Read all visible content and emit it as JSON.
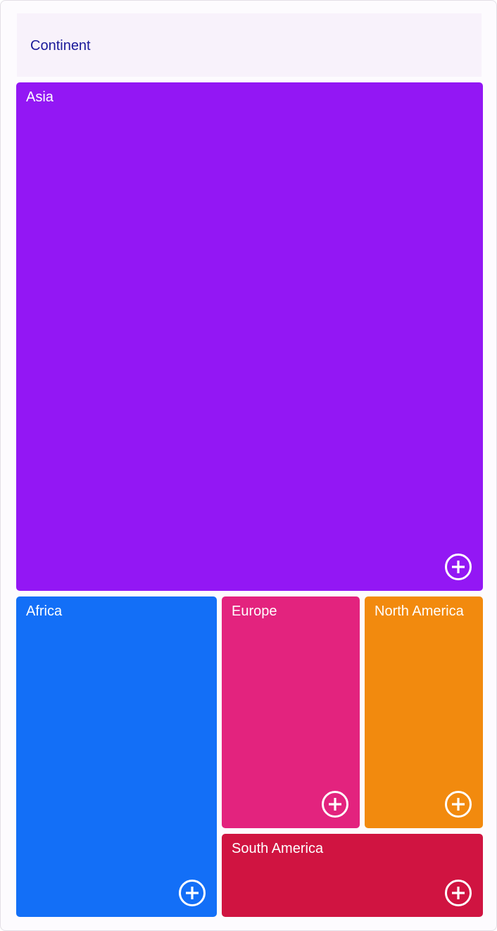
{
  "header": {
    "title": "Continent"
  },
  "tiles": [
    {
      "label": "Asia",
      "color": "#9317f4",
      "icon": "plus-circle-icon"
    },
    {
      "label": "Africa",
      "color": "#136ff7",
      "icon": "plus-circle-icon"
    },
    {
      "label": "Europe",
      "color": "#e3237e",
      "icon": "plus-circle-icon"
    },
    {
      "label": "North America",
      "color": "#f28a0e",
      "icon": "plus-circle-icon"
    },
    {
      "label": "South America",
      "color": "#d01441",
      "icon": "plus-circle-icon"
    }
  ]
}
